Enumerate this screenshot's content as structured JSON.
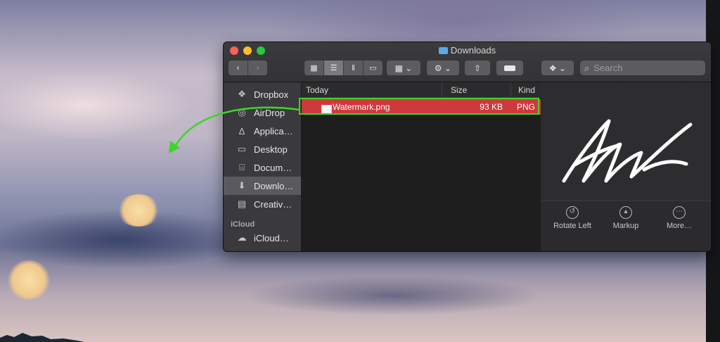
{
  "window": {
    "title": "Downloads"
  },
  "toolbar": {
    "back_icon": "chevron-left-icon",
    "forward_icon": "chevron-right-icon",
    "view_icons": [
      "icon-view-icon",
      "list-view-icon",
      "column-view-icon",
      "gallery-view-icon"
    ],
    "group_icon": "group-by-icon",
    "action_icon": "gear-icon",
    "share_icon": "share-icon",
    "tag_icon": "tag-icon",
    "dropbox_icon": "dropbox-icon",
    "search_placeholder": "Search"
  },
  "sidebar": {
    "favorites": [
      {
        "label": "Dropbox",
        "icon": "dropbox-icon"
      },
      {
        "label": "AirDrop",
        "icon": "airdrop-icon"
      },
      {
        "label": "Applica…",
        "icon": "applications-icon"
      },
      {
        "label": "Desktop",
        "icon": "desktop-icon"
      },
      {
        "label": "Docum…",
        "icon": "documents-icon"
      },
      {
        "label": "Downlo…",
        "icon": "downloads-icon",
        "selected": true
      },
      {
        "label": "Creativ…",
        "icon": "folder-icon"
      }
    ],
    "icloud_header": "iCloud",
    "icloud": [
      {
        "label": "iCloud…",
        "icon": "cloud-icon"
      }
    ]
  },
  "list": {
    "columns": {
      "name": "Today",
      "size": "Size",
      "kind": "Kind"
    },
    "rows": [
      {
        "name": "Watermark.png",
        "size": "93 KB",
        "kind": "PNG",
        "selected": true
      }
    ]
  },
  "preview": {
    "actions": [
      {
        "label": "Rotate Left",
        "icon": "rotate-left-icon"
      },
      {
        "label": "Markup",
        "icon": "markup-icon"
      },
      {
        "label": "More…",
        "icon": "more-icon"
      }
    ]
  },
  "colors": {
    "selection_red": "#d0393c",
    "annotation_green": "#3fd52a",
    "window_bg": "#2a2a2c"
  }
}
